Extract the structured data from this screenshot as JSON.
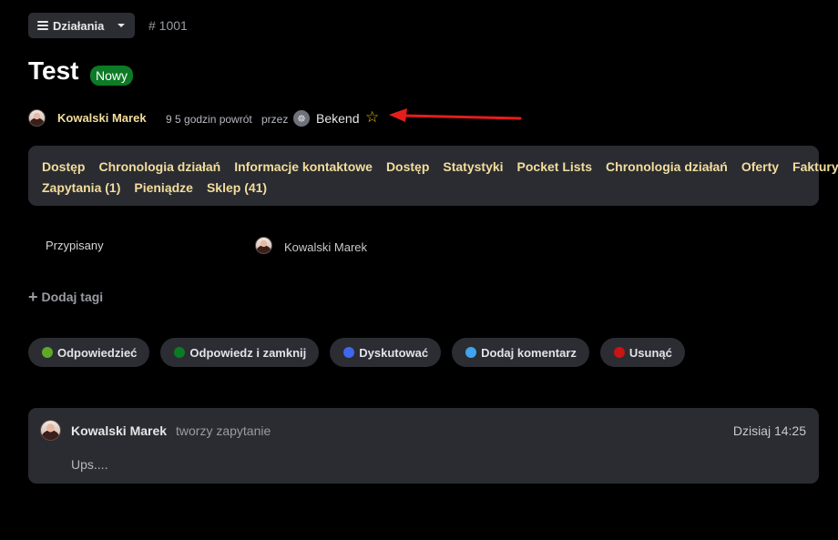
{
  "header": {
    "actions_label": "Działania",
    "ticket_number": "# 1001"
  },
  "ticket": {
    "title": "Test",
    "status": "Nowy",
    "status_color": "#0d7a25"
  },
  "meta": {
    "author": "Kowalski Marek",
    "time": "9 5 godzin powrót",
    "by_label": "przez",
    "group": "Bekend",
    "favorite_icon": "star-outline-icon",
    "annotation": "red-arrow"
  },
  "tabs": [
    [
      "Dostęp",
      "Chronologia działań",
      "Informacje kontaktowe",
      "Dostęp",
      "Statystyki",
      "Pocket Lists",
      "Chronologia działań",
      "Oferty",
      "Faktury"
    ],
    [
      "Zapytania (1)",
      "Pieniądze",
      "Sklep (41)"
    ]
  ],
  "assigned": {
    "label": "Przypisany",
    "name": "Kowalski Marek"
  },
  "tags": {
    "add_label": "Dodaj tagi"
  },
  "actions": [
    {
      "label": "Odpowiedzieć",
      "color": "#5fa82a"
    },
    {
      "label": "Odpowiedz i zamknij",
      "color": "#0d7a25"
    },
    {
      "label": "Dyskutować",
      "color": "#3f67f0"
    },
    {
      "label": "Dodaj komentarz",
      "color": "#3fa3f0"
    },
    {
      "label": "Usunąć",
      "color": "#c81414"
    }
  ],
  "comment": {
    "author": "Kowalski Marek",
    "verb": "tworzy zapytanie",
    "time": "Dzisiaj 14:25",
    "body": "Ups...."
  },
  "colors": {
    "background": "#000000",
    "panel": "#2a2c32",
    "link": "#f3dd9c"
  }
}
